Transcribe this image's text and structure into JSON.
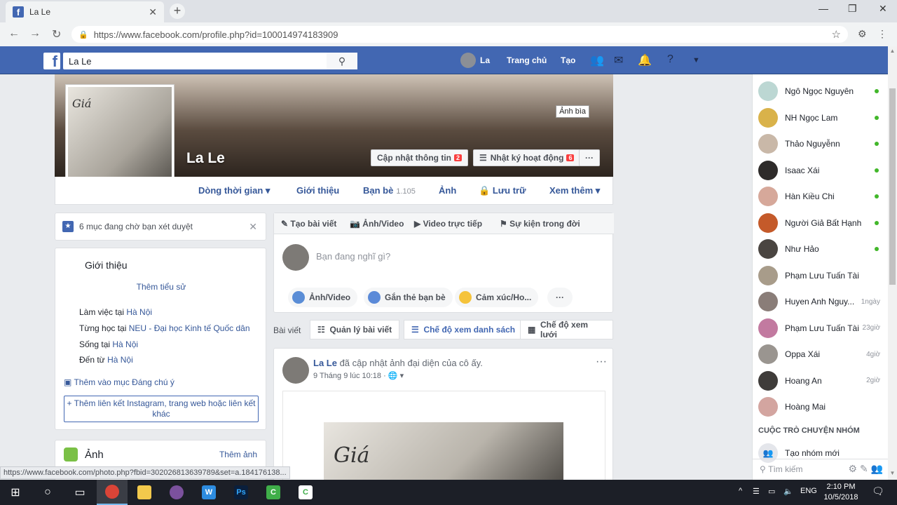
{
  "browser": {
    "tab_title": "La Le",
    "url": "https://www.facebook.com/profile.php?id=100014974183909",
    "new_tab": "+",
    "close_tab": "✕",
    "min": "—",
    "restore": "❐",
    "close": "✕"
  },
  "fb": {
    "logo": "f",
    "search_value": "La Le",
    "user_name": "La",
    "home": "Trang chủ",
    "create": "Tạo"
  },
  "profile": {
    "name": "La Le",
    "cover_tooltip": "Ảnh bìa",
    "update_info": "Cập nhật thông tin",
    "update_info_badge": "2",
    "activity_log": "Nhật ký hoạt động",
    "activity_log_badge": "6",
    "more": "···",
    "pic_text": "Giá"
  },
  "profile_nav": {
    "timeline": "Dòng thời gian ▾",
    "about": "Giới thiệu",
    "friends": "Bạn bè",
    "friends_count": "1.105",
    "photos": "Ảnh",
    "archive": "Lưu trữ",
    "more": "Xem thêm ▾"
  },
  "pending": {
    "text": "6 mục đang chờ bạn xét duyệt"
  },
  "intro": {
    "title": "Giới thiệu",
    "add_bio": "Thêm tiểu sử",
    "work_prefix": "Làm việc tại ",
    "work_place": "Hà Nội",
    "study_prefix": "Từng học tại ",
    "study_place": "NEU - Đại học Kinh tế Quốc dân",
    "lives_prefix": "Sống tại ",
    "lives_place": "Hà Nội",
    "from_prefix": "Đến từ ",
    "from_place": "Hà Nội",
    "featured": "Thêm vào mục Đáng chú ý",
    "add_link": "+ Thêm liên kết Instagram, trang web hoặc liên kết khác"
  },
  "photos_card": {
    "title": "Ảnh",
    "more": "Thêm ảnh"
  },
  "composer": {
    "tab_post": "Tạo bài viết",
    "tab_photo": "Ảnh/Video",
    "tab_live": "Video trực tiếp",
    "tab_event": "Sự kiện trong đời",
    "placeholder": "Bạn đang nghĩ gì?",
    "photo": "Ảnh/Video",
    "tag": "Gắn thẻ bạn bè",
    "feeling": "Cảm xúc/Ho...",
    "more": "···"
  },
  "postbar": {
    "label": "Bài viết",
    "manage": "Quản lý bài viết",
    "list_view": "Chế độ xem danh sách",
    "grid_view": "Chế độ xem lưới"
  },
  "post": {
    "author": "La Le",
    "action": " đã cập nhật ảnh đại diện của cô ấy.",
    "date": "9 Tháng 9 lúc 10:18 · 🌐 ▾",
    "more": "···",
    "image_text": "Giá"
  },
  "chat": {
    "contacts": [
      {
        "name": "Ngô Ngọc Nguyên",
        "status": "online",
        "ago": "",
        "color": "#bcd7d3"
      },
      {
        "name": "NH Ngọc Lam",
        "status": "online",
        "ago": "",
        "color": "#d9b24a"
      },
      {
        "name": "Thảo Nguyễnn",
        "status": "online",
        "ago": "",
        "color": "#c9b8a8"
      },
      {
        "name": "Isaac Xái",
        "status": "online",
        "ago": "",
        "color": "#2e2b2a"
      },
      {
        "name": "Hàn Kiều Chi",
        "status": "online",
        "ago": "",
        "color": "#d6a89a"
      },
      {
        "name": "Người Giả Bất Hạnh",
        "status": "online",
        "ago": "",
        "color": "#c45a2a"
      },
      {
        "name": "Như Hảo",
        "status": "online",
        "ago": "",
        "color": "#4a4541"
      },
      {
        "name": "Phạm Lưu Tuấn Tài",
        "status": "offline",
        "ago": "",
        "color": "#a89c8a"
      },
      {
        "name": "Huyen Anh Nguy...",
        "status": "offline",
        "ago": "1ngày",
        "color": "#8a7d78"
      },
      {
        "name": "Phạm Lưu Tuấn Tài",
        "status": "offline",
        "ago": "23giờ",
        "color": "#c27aa0"
      },
      {
        "name": "Oppa Xái",
        "status": "offline",
        "ago": "4giờ",
        "color": "#9a9590"
      },
      {
        "name": "Hoang An",
        "status": "offline",
        "ago": "2giờ",
        "color": "#3f3c3a"
      },
      {
        "name": "Hoàng Mai",
        "status": "offline",
        "ago": "",
        "color": "#d3a5a0"
      }
    ],
    "group_header": "CUỘC TRÒ CHUYỆN NHÓM",
    "new_group": "Tạo nhóm mới",
    "search_placeholder": "Tìm kiếm"
  },
  "status_url": "https://www.facebook.com/photo.php?fbid=302026813639789&set=a.184176138...",
  "taskbar": {
    "lang": "ENG",
    "time": "2:10 PM",
    "date": "10/5/2018"
  },
  "colors": {
    "fb_blue": "#4267b2",
    "link": "#365899",
    "online": "#42b72a"
  }
}
